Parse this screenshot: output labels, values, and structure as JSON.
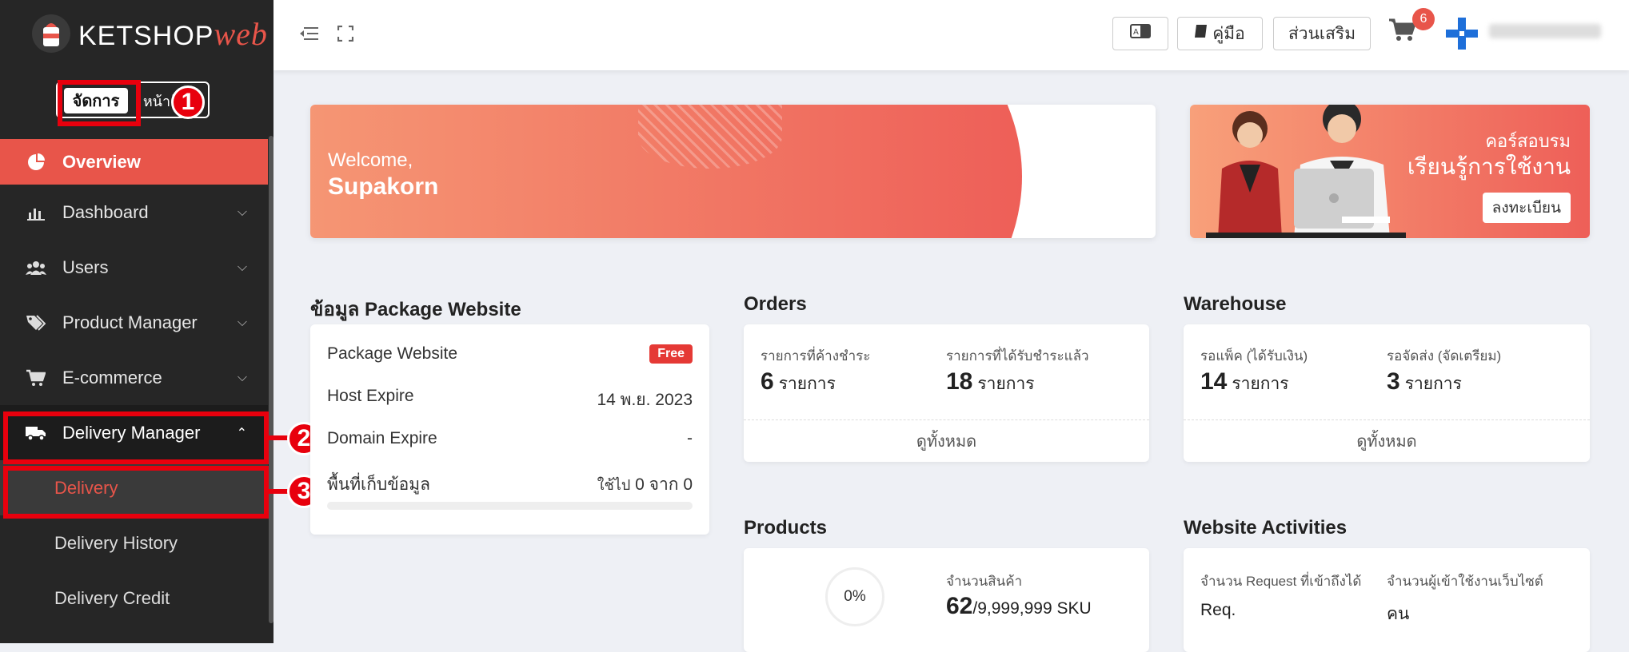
{
  "sidebar": {
    "logo_main": "KETSHOP",
    "logo_accent": "web",
    "mode_active": "จัดการ",
    "mode_other": "หน้าร้าน",
    "items": [
      {
        "label": "Overview"
      },
      {
        "label": "Dashboard"
      },
      {
        "label": "Users"
      },
      {
        "label": "Product Manager"
      },
      {
        "label": "E-commerce"
      },
      {
        "label": "Delivery Manager"
      },
      {
        "label": "Delivery"
      },
      {
        "label": "Delivery History"
      },
      {
        "label": "Delivery Credit"
      }
    ],
    "markers": [
      "1",
      "2",
      "3"
    ]
  },
  "topbar": {
    "manual_label": "คู่มือ",
    "addons_label": "ส่วนเสริม",
    "cart_count": "6"
  },
  "welcome": {
    "greeting": "Welcome,",
    "name": "Supakorn"
  },
  "course_banner": {
    "line1": "คอร์สอบรม",
    "line2": "เรียนรู้การใช้งาน",
    "button": "ลงทะเบียน"
  },
  "package": {
    "title": "ข้อมูล Package Website",
    "rows": [
      {
        "label": "Package Website",
        "value": "Free"
      },
      {
        "label": "Host Expire",
        "value": "14 พ.ย. 2023"
      },
      {
        "label": "Domain Expire",
        "value": "-"
      },
      {
        "label": "พื้นที่เก็บข้อมูล",
        "value_prefix": "ใช้ไป",
        "value_used": "0",
        "value_mid": "จาก",
        "value_total": "0"
      }
    ]
  },
  "orders": {
    "title": "Orders",
    "pending_label": "รายการที่ค้างชำระ",
    "pending_value": "6",
    "paid_label": "รายการที่ได้รับชำระแล้ว",
    "paid_value": "18",
    "unit": "รายการ",
    "view_all": "ดูทั้งหมด"
  },
  "warehouse": {
    "title": "Warehouse",
    "pack_label": "รอแพ็ค (ได้รับเงิน)",
    "pack_value": "14",
    "ship_label": "รอจัดส่ง (จัดเตรียม)",
    "ship_value": "3",
    "unit": "รายการ",
    "view_all": "ดูทั้งหมด"
  },
  "products": {
    "title": "Products",
    "percent": "0%",
    "count_label": "จำนวนสินค้า",
    "count": "62",
    "limit": "/9,999,999 SKU"
  },
  "activities": {
    "title": "Website Activities",
    "req_label": "จำนวน Request ที่เข้าถึงได้",
    "req_unit": "Req.",
    "users_label": "จำนวนผู้เข้าใช้งานเว็บไซต์",
    "users_unit": "คน"
  }
}
